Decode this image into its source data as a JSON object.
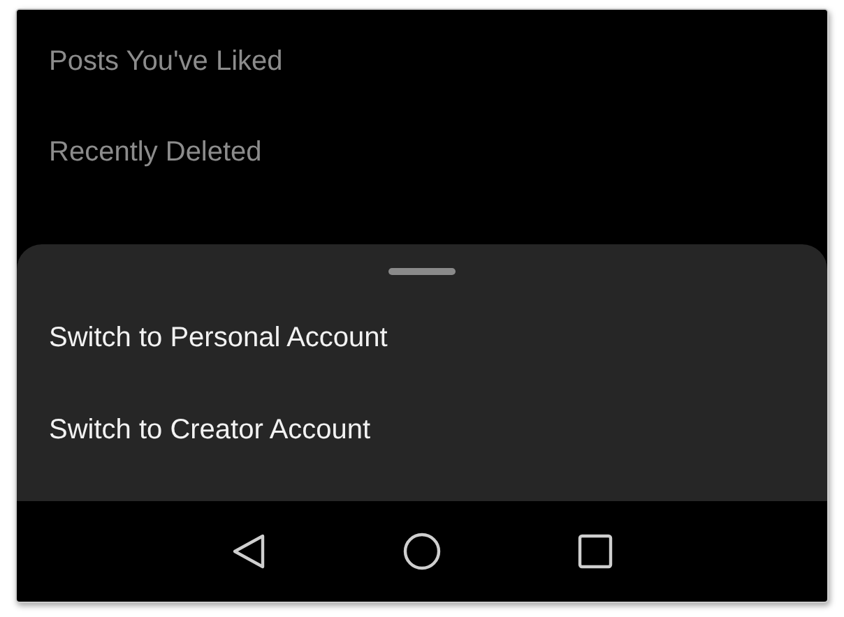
{
  "menu": {
    "items": [
      {
        "label": "Posts You've Liked"
      },
      {
        "label": "Recently Deleted"
      }
    ]
  },
  "sheet": {
    "options": [
      {
        "label": "Switch to Personal Account"
      },
      {
        "label": "Switch to Creator Account"
      }
    ]
  },
  "nav_bar": {
    "buttons": [
      {
        "kind": "back"
      },
      {
        "kind": "home"
      },
      {
        "kind": "recents"
      }
    ]
  }
}
